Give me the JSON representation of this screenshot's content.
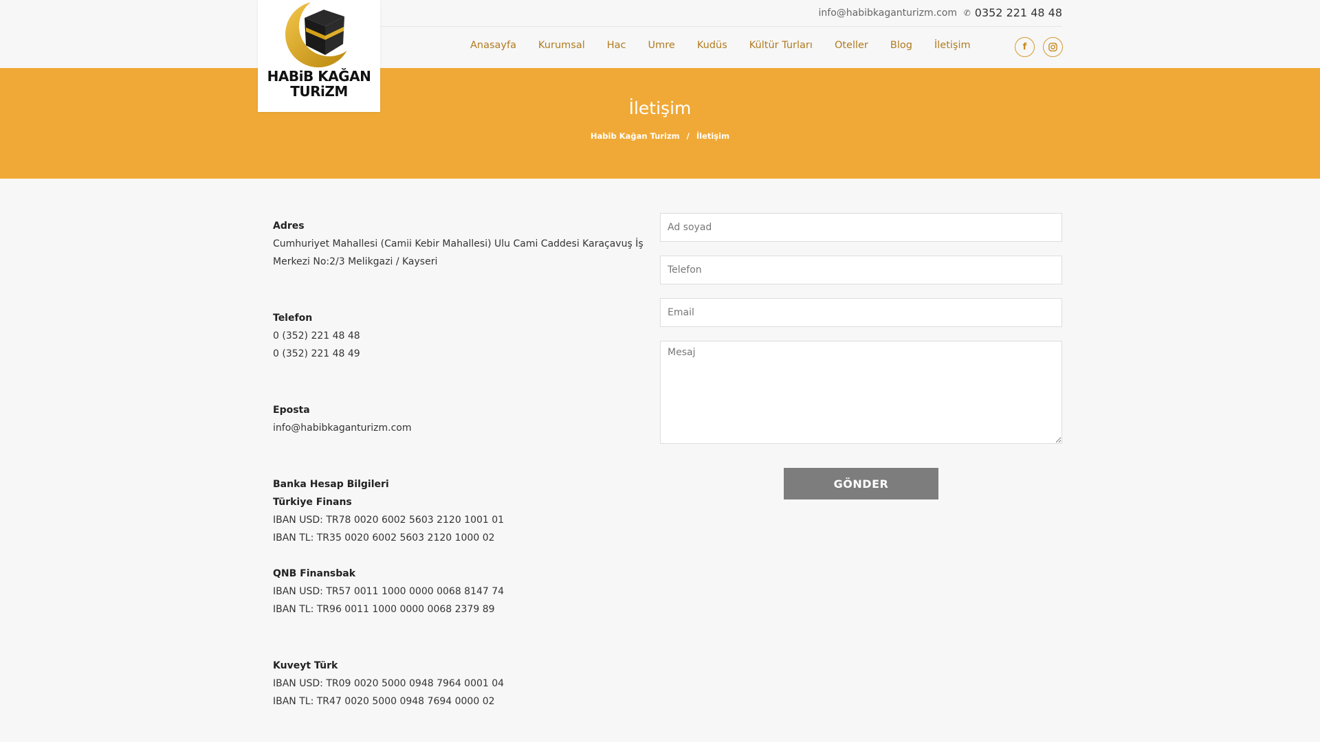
{
  "topbar": {
    "email": "info@habibkaganturizm.com",
    "phone": "0352 221 48 48",
    "phone_icon": "phone-icon"
  },
  "logo": {
    "line1": "HABiB KAĞAN",
    "line2": "TURiZM"
  },
  "nav": {
    "items": [
      {
        "label": "Anasayfa"
      },
      {
        "label": "Kurumsal"
      },
      {
        "label": "Hac"
      },
      {
        "label": "Umre"
      },
      {
        "label": "Kudüs"
      },
      {
        "label": "Kültür Turları"
      },
      {
        "label": "Oteller"
      },
      {
        "label": "Blog"
      },
      {
        "label": "İletişim"
      }
    ]
  },
  "social": {
    "facebook": "f",
    "instagram": "◎"
  },
  "banner": {
    "title": "İletişim",
    "breadcrumb": [
      "Habib Kağan Turizm",
      "/",
      "İletişim"
    ]
  },
  "contact": {
    "address_label": "Adres",
    "address_line1": "Cumhuriyet Mahallesi (Camii Kebir Mahallesi) Ulu Cami Caddesi Karaçavuş İş",
    "address_line2": "Merkezi No:2/3 Melikgazi / Kayseri",
    "phone_label": "Telefon",
    "phone1": "0 (352) 221 48 48",
    "phone2": "0 (352) 221 48 49",
    "email_label": "Eposta",
    "email": "info@habibkaganturizm.com",
    "bank_label": "Banka Hesap Bilgileri",
    "banks": [
      {
        "name": "Türkiye Finans",
        "usd": "IBAN USD: TR78 0020 6002 5603 2120 1001 01",
        "tl": "IBAN TL: TR35 0020 6002 5603 2120 1000 02"
      },
      {
        "name": "QNB Finansbak",
        "usd": "IBAN USD: TR57 0011 1000 0000 0068 8147 74",
        "tl": "IBAN TL: TR96 0011 1000 0000 0068 2379 89"
      },
      {
        "name": "Kuveyt Türk",
        "usd": "IBAN USD: TR09 0020 5000 0948 7964 0001 04",
        "tl": "IBAN TL: TR47 0020 5000 0948 7694 0000 02"
      }
    ]
  },
  "form": {
    "name_placeholder": "Ad soyad",
    "phone_placeholder": "Telefon",
    "email_placeholder": "Email",
    "message_placeholder": "Mesaj",
    "submit_label": "GÖNDER"
  },
  "colors": {
    "accent": "#f0a936",
    "nav_text": "#b07a1f",
    "button": "#7d7d7d"
  }
}
